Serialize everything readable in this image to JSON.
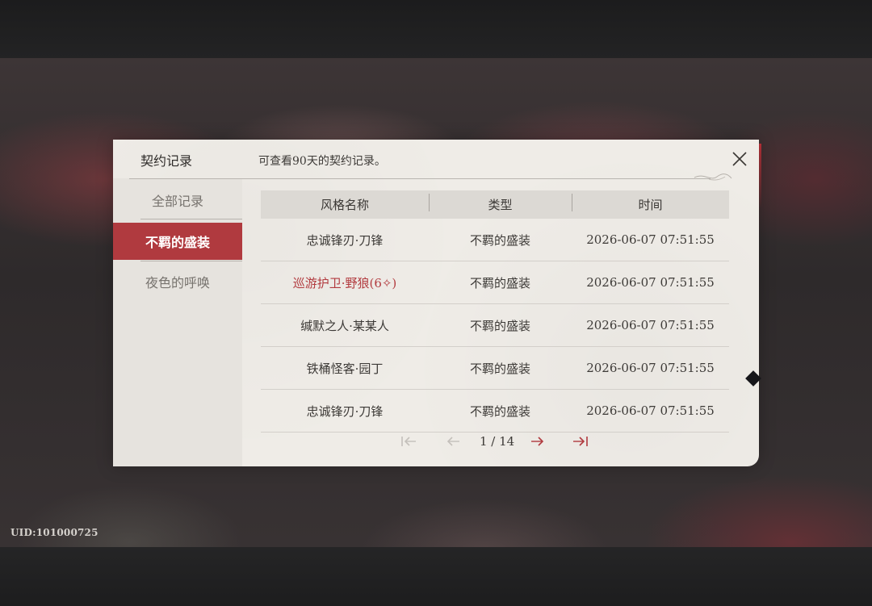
{
  "dialog": {
    "title": "契约记录",
    "subtitle": "可查看90天的契约记录。"
  },
  "sidebar": {
    "items": [
      {
        "label": "全部记录",
        "active": false
      },
      {
        "label": "不羁的盛装",
        "active": true
      },
      {
        "label": "夜色的呼唤",
        "active": false
      }
    ]
  },
  "table": {
    "headers": [
      "风格名称",
      "类型",
      "时间"
    ],
    "rows": [
      {
        "name": "忠诚锋刃·刀锋",
        "type": "不羁的盛装",
        "time": "2026-06-07 07:51:55",
        "highlight": false
      },
      {
        "name": "巡游护卫·野狼(6✧)",
        "type": "不羁的盛装",
        "time": "2026-06-07 07:51:55",
        "highlight": true
      },
      {
        "name": "缄默之人·某某人",
        "type": "不羁的盛装",
        "time": "2026-06-07 07:51:55",
        "highlight": false
      },
      {
        "name": "铁桶怪客·园丁",
        "type": "不羁的盛装",
        "time": "2026-06-07 07:51:55",
        "highlight": false
      },
      {
        "name": "忠诚锋刃·刀锋",
        "type": "不羁的盛装",
        "time": "2026-06-07 07:51:55",
        "highlight": false
      }
    ]
  },
  "pagination": {
    "current_page": 1,
    "total_pages": 14,
    "label": "1 / 14"
  },
  "footer": {
    "uid": "UID:101000725"
  },
  "colors": {
    "accent_red": "#b03a3f",
    "highlight_text": "#b23b3f",
    "paper": "#efece7"
  },
  "icons": {
    "close": "close-icon",
    "first": "first-page-icon",
    "prev": "prev-page-icon",
    "next": "next-page-icon",
    "last": "last-page-icon"
  }
}
